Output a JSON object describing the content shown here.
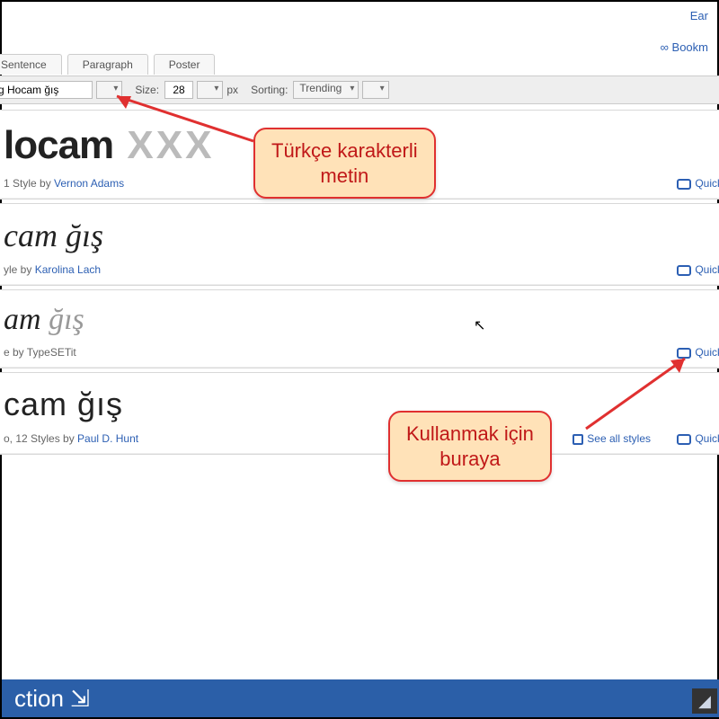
{
  "top_links": {
    "earlier": "Ear",
    "bookmark": "∞ Bookm"
  },
  "tabs": {
    "sentence": "Sentence",
    "paragraph": "Paragraph",
    "poster": "Poster"
  },
  "toolbar": {
    "preview_value": "g Hocam ğış",
    "size_label": "Size:",
    "size_value": "28",
    "size_unit": "px",
    "sort_label": "Sorting:",
    "sort_value": "Trending"
  },
  "fonts": [
    {
      "sample_main": "locam",
      "sample_miss": " XXX",
      "meta_prefix": "1 Style by ",
      "author": "Vernon Adams",
      "quick": "Quick"
    },
    {
      "sample_main": "cam ğış",
      "sample_miss": "",
      "meta_prefix": "yle by ",
      "author": "Karolina Lach",
      "quick": "Quick"
    },
    {
      "sample_main": "am ",
      "sample_miss": "ğış",
      "meta_prefix": "e by TypeSETit",
      "author": "",
      "quick": "Quick"
    },
    {
      "sample_main": "cam ğış",
      "sample_miss": "",
      "meta_prefix": "o, 12 Styles by ",
      "author": "Paul D. Hunt",
      "quick": "Quick",
      "see_all": "See all styles"
    }
  ],
  "callouts": {
    "c1": "Türkçe karakterli\nmetin",
    "c2": "Kullanmak için\nburaya"
  },
  "bottom": {
    "label": "ction ⇲"
  }
}
